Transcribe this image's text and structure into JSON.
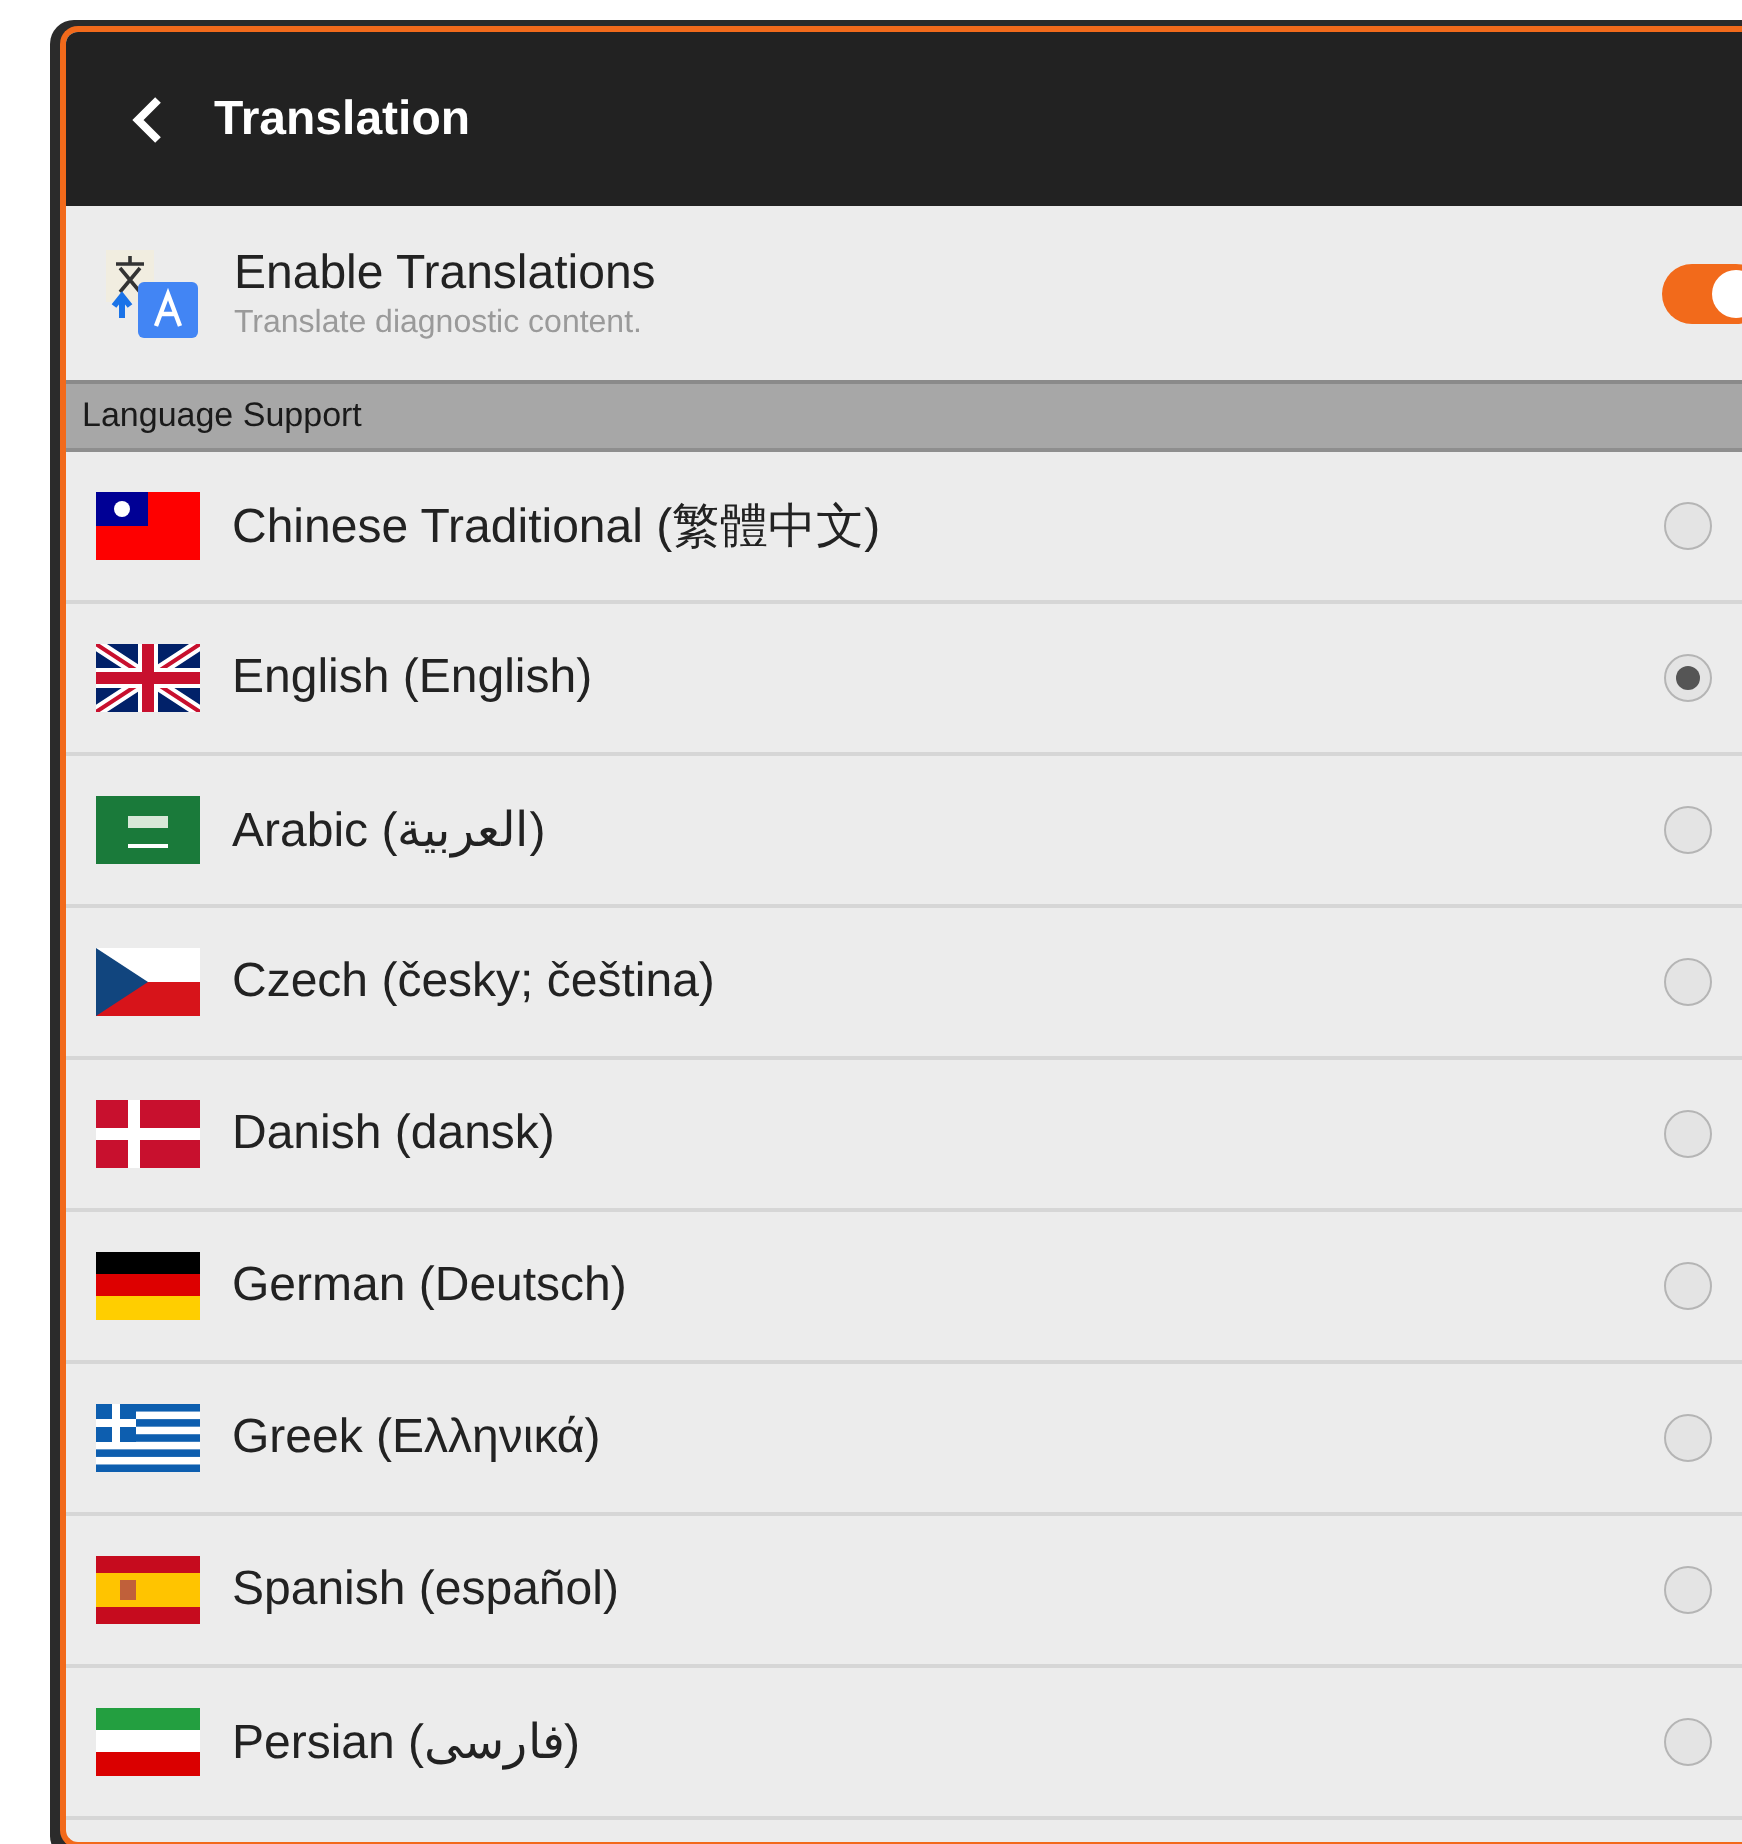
{
  "header": {
    "title": "Translation"
  },
  "setting": {
    "title": "Enable Translations",
    "subtitle": "Translate diagnostic content.",
    "on": true
  },
  "section": {
    "title": "Language Support"
  },
  "languages": [
    {
      "label": "Chinese Traditional (繁體中文)",
      "selected": false
    },
    {
      "label": "English (English)",
      "selected": true
    },
    {
      "label": "Arabic (العربية)",
      "selected": false
    },
    {
      "label": "Czech (česky; čeština)",
      "selected": false
    },
    {
      "label": "Danish (dansk)",
      "selected": false
    },
    {
      "label": "German (Deutsch)",
      "selected": false
    },
    {
      "label": "Greek (Ελληνικά)",
      "selected": false
    },
    {
      "label": "Spanish (español)",
      "selected": false
    },
    {
      "label": "Persian (فارسی)",
      "selected": false
    }
  ]
}
